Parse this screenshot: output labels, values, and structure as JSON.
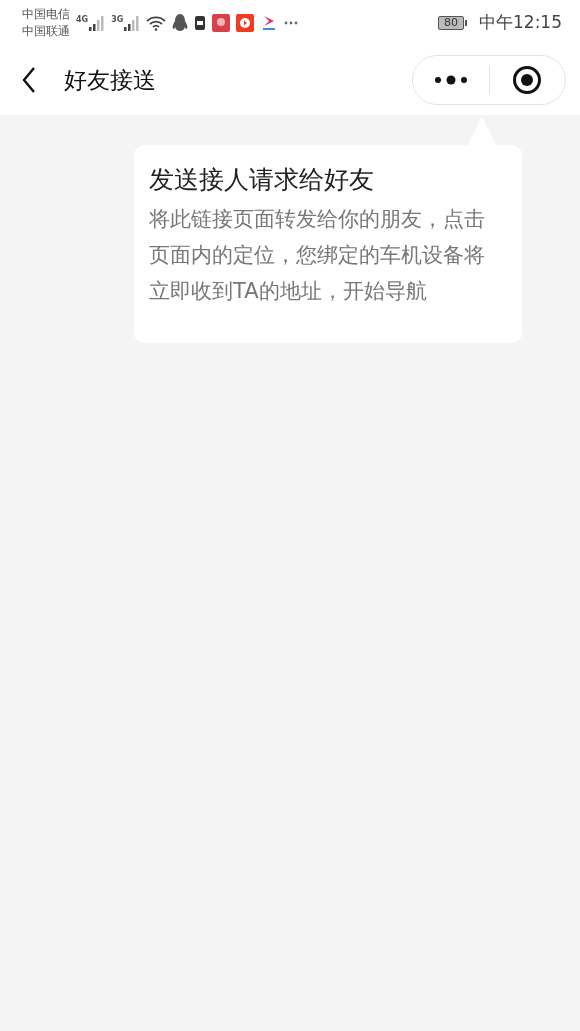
{
  "status_bar": {
    "carriers": [
      "中国电信",
      "中国联通"
    ],
    "networks": [
      "4G",
      "3G"
    ],
    "battery": "80",
    "time": "中午12:15"
  },
  "nav_bar": {
    "title": "好友接送"
  },
  "popover": {
    "title": "发送接人请求给好友",
    "body": "将此链接页面转发给你的朋友，点击页面内的定位，您绑定的车机设备将立即收到TA的地址，开始导航"
  }
}
